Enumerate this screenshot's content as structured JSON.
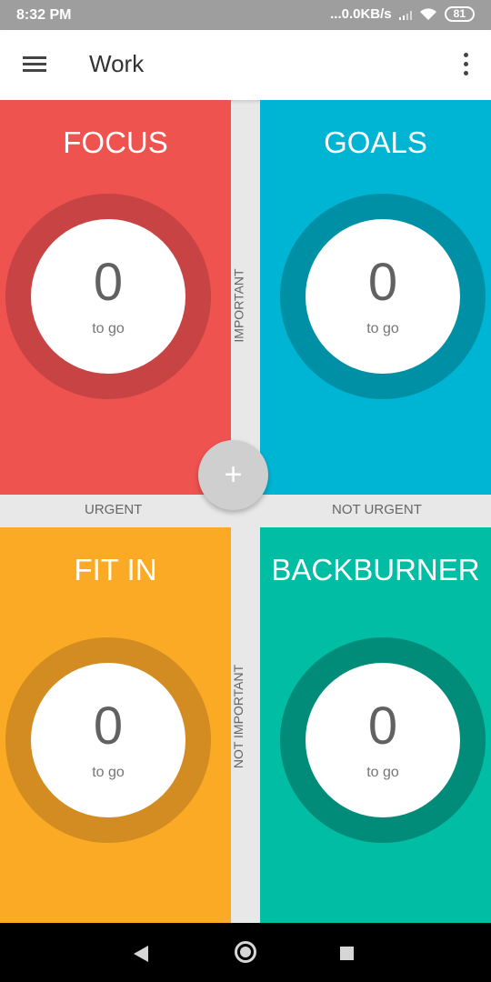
{
  "status_bar": {
    "time": "8:32 PM",
    "network_speed": "...0.0KB/s",
    "battery": "81"
  },
  "app_bar": {
    "title": "Work"
  },
  "quadrants": [
    {
      "title": "FOCUS",
      "count": "0",
      "caption": "to go",
      "color": "#ef5350",
      "ring_color": "#c84344"
    },
    {
      "title": "GOALS",
      "count": "0",
      "caption": "to go",
      "color": "#00b5d4",
      "ring_color": "#0090a5"
    },
    {
      "title": "FIT IN",
      "count": "0",
      "caption": "to go",
      "color": "#fbaa26",
      "ring_color": "#d38c21"
    },
    {
      "title": "BACKBURNER",
      "count": "0",
      "caption": "to go",
      "color": "#00bda3",
      "ring_color": "#008c79"
    }
  ],
  "axis_labels": {
    "important": "IMPORTANT",
    "not_important": "NOT IMPORTANT",
    "urgent": "URGENT",
    "not_urgent": "NOT URGENT"
  },
  "fab": {
    "symbol": "+"
  },
  "icons": [
    "menu-icon",
    "more-vert-icon",
    "signal-icon",
    "wifi-icon",
    "battery-icon",
    "back-icon",
    "home-icon",
    "recents-icon",
    "add-icon"
  ]
}
